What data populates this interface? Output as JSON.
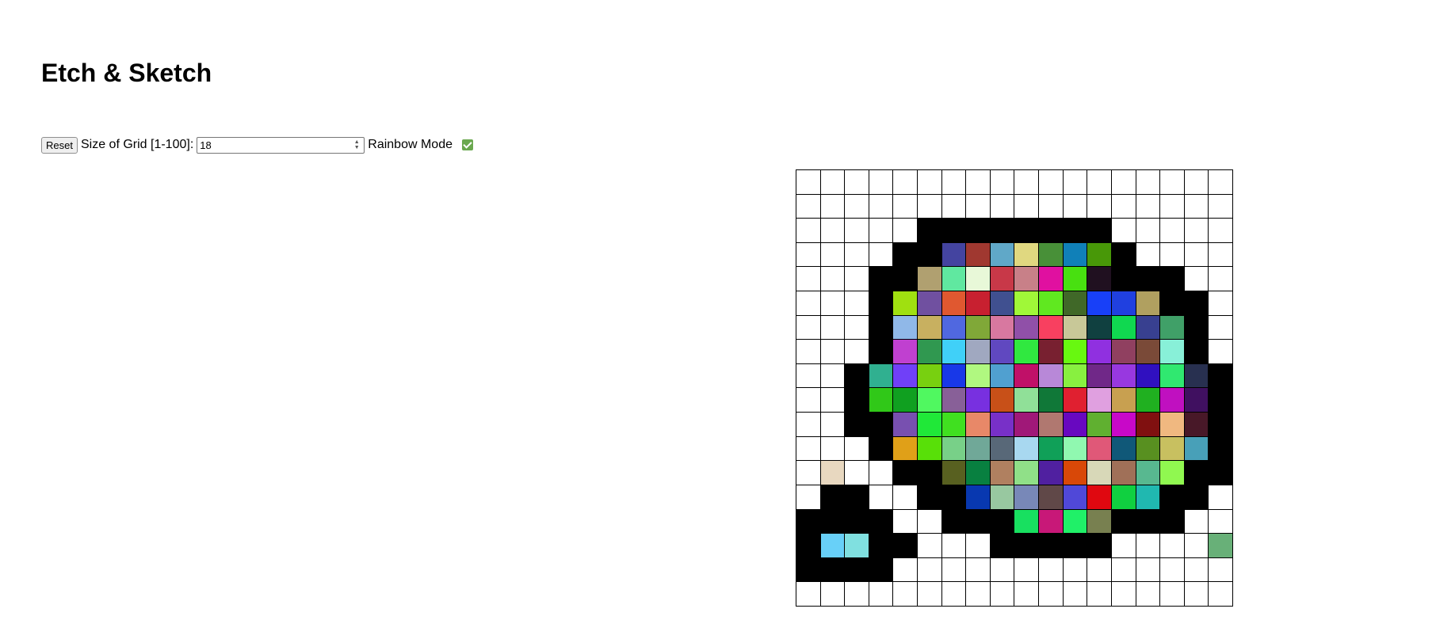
{
  "title": "Etch & Sketch",
  "controls": {
    "reset_label": "Reset",
    "size_label": "Size of Grid [1-100]:",
    "size_value": "18",
    "rainbow_label": "Rainbow Mode",
    "rainbow_checked": true
  },
  "grid": {
    "size": 18,
    "cells": [
      [
        "#ffffff",
        "#ffffff",
        "#ffffff",
        "#ffffff",
        "#ffffff",
        "#ffffff",
        "#ffffff",
        "#ffffff",
        "#ffffff",
        "#ffffff",
        "#ffffff",
        "#ffffff",
        "#ffffff",
        "#ffffff",
        "#ffffff",
        "#ffffff",
        "#ffffff",
        "#ffffff"
      ],
      [
        "#ffffff",
        "#ffffff",
        "#ffffff",
        "#ffffff",
        "#ffffff",
        "#ffffff",
        "#ffffff",
        "#ffffff",
        "#ffffff",
        "#ffffff",
        "#ffffff",
        "#ffffff",
        "#ffffff",
        "#ffffff",
        "#ffffff",
        "#ffffff",
        "#ffffff",
        "#ffffff"
      ],
      [
        "#ffffff",
        "#ffffff",
        "#ffffff",
        "#ffffff",
        "#ffffff",
        "#000000",
        "#000000",
        "#000000",
        "#000000",
        "#000000",
        "#000000",
        "#000000",
        "#000000",
        "#ffffff",
        "#ffffff",
        "#ffffff",
        "#ffffff",
        "#ffffff"
      ],
      [
        "#ffffff",
        "#ffffff",
        "#ffffff",
        "#ffffff",
        "#000000",
        "#000000",
        "#4444a0",
        "#a03830",
        "#60a8c8",
        "#e0d880",
        "#489038",
        "#1080b8",
        "#489808",
        "#000000",
        "#ffffff",
        "#ffffff",
        "#ffffff",
        "#ffffff"
      ],
      [
        "#ffffff",
        "#ffffff",
        "#ffffff",
        "#000000",
        "#000000",
        "#b0a070",
        "#60e8a0",
        "#e8f8d8",
        "#c83848",
        "#c88088",
        "#e010a0",
        "#48e010",
        "#201020",
        "#000000",
        "#000000",
        "#000000",
        "#ffffff",
        "#ffffff"
      ],
      [
        "#ffffff",
        "#ffffff",
        "#ffffff",
        "#000000",
        "#a0e010",
        "#7050a0",
        "#e05830",
        "#c82030",
        "#405090",
        "#a0f838",
        "#60e820",
        "#406828",
        "#1840f8",
        "#2040e0",
        "#b0a060",
        "#000000",
        "#000000",
        "#ffffff"
      ],
      [
        "#ffffff",
        "#ffffff",
        "#ffffff",
        "#000000",
        "#90b8e8",
        "#c8b060",
        "#5068e0",
        "#80a838",
        "#d878a0",
        "#9050a8",
        "#f84060",
        "#c8c898",
        "#104040",
        "#10d850",
        "#384090",
        "#40a068",
        "#000000",
        "#ffffff"
      ],
      [
        "#ffffff",
        "#ffffff",
        "#ffffff",
        "#000000",
        "#c040d0",
        "#309850",
        "#40d0f8",
        "#a0a8c0",
        "#6048c0",
        "#30e840",
        "#782030",
        "#68f810",
        "#9030e0",
        "#904060",
        "#7a4a38",
        "#88f0d8",
        "#000000",
        "#ffffff"
      ],
      [
        "#ffffff",
        "#ffffff",
        "#000000",
        "#30b090",
        "#7040f8",
        "#78d010",
        "#1838e8",
        "#b0f880",
        "#50a0d0",
        "#c01068",
        "#b888d8",
        "#88f040",
        "#702888",
        "#9838e0",
        "#3010c0",
        "#30e870",
        "#283050",
        "#000000"
      ],
      [
        "#ffffff",
        "#ffffff",
        "#000000",
        "#30c818",
        "#10a020",
        "#50f860",
        "#886098",
        "#7830e0",
        "#c85018",
        "#90e098",
        "#107838",
        "#e02030",
        "#e0a0e0",
        "#c8a050",
        "#20b020",
        "#c010c0",
        "#401060",
        "#000000"
      ],
      [
        "#ffffff",
        "#ffffff",
        "#000000",
        "#000000",
        "#7850b0",
        "#20e838",
        "#40e020",
        "#e88868",
        "#7830c8",
        "#a01878",
        "#b07870",
        "#6808c0",
        "#60b030",
        "#c808c8",
        "#801010",
        "#f0b880",
        "#481828",
        "#000000"
      ],
      [
        "#ffffff",
        "#ffffff",
        "#ffffff",
        "#000000",
        "#e0a018",
        "#58e008",
        "#78d088",
        "#70a898",
        "#586878",
        "#a8d8f0",
        "#10a058",
        "#90f8b0",
        "#e05878",
        "#105878",
        "#589020",
        "#c8c060",
        "#48a0b8",
        "#000000"
      ],
      [
        "#ffffff",
        "#e8d8c0",
        "#ffffff",
        "#ffffff",
        "#000000",
        "#000000",
        "#586020",
        "#088040",
        "#b08060",
        "#90e088",
        "#5020a0",
        "#d84808",
        "#d8d8b8",
        "#a07058",
        "#58b890",
        "#90f850",
        "#000000",
        "#000000"
      ],
      [
        "#ffffff",
        "#000000",
        "#000000",
        "#ffffff",
        "#ffffff",
        "#000000",
        "#000000",
        "#0838b0",
        "#98c8a0",
        "#7888b8",
        "#604848",
        "#5048d8",
        "#e00810",
        "#10d040",
        "#20b8b0",
        "#000000",
        "#000000",
        "#ffffff"
      ],
      [
        "#000000",
        "#000000",
        "#000000",
        "#000000",
        "#ffffff",
        "#ffffff",
        "#000000",
        "#000000",
        "#000000",
        "#18e060",
        "#c81878",
        "#20f068",
        "#788050",
        "#000000",
        "#000000",
        "#000000",
        "#ffffff",
        "#ffffff"
      ],
      [
        "#000000",
        "#68d0f8",
        "#80e0e0",
        "#000000",
        "#000000",
        "#ffffff",
        "#ffffff",
        "#ffffff",
        "#000000",
        "#000000",
        "#000000",
        "#000000",
        "#000000",
        "#ffffff",
        "#ffffff",
        "#ffffff",
        "#ffffff",
        "#68b078"
      ],
      [
        "#000000",
        "#000000",
        "#000000",
        "#000000",
        "#ffffff",
        "#ffffff",
        "#ffffff",
        "#ffffff",
        "#ffffff",
        "#ffffff",
        "#ffffff",
        "#ffffff",
        "#ffffff",
        "#ffffff",
        "#ffffff",
        "#ffffff",
        "#ffffff",
        "#ffffff"
      ],
      [
        "#ffffff",
        "#ffffff",
        "#ffffff",
        "#ffffff",
        "#ffffff",
        "#ffffff",
        "#ffffff",
        "#ffffff",
        "#ffffff",
        "#ffffff",
        "#ffffff",
        "#ffffff",
        "#ffffff",
        "#ffffff",
        "#ffffff",
        "#ffffff",
        "#ffffff",
        "#ffffff"
      ]
    ]
  }
}
